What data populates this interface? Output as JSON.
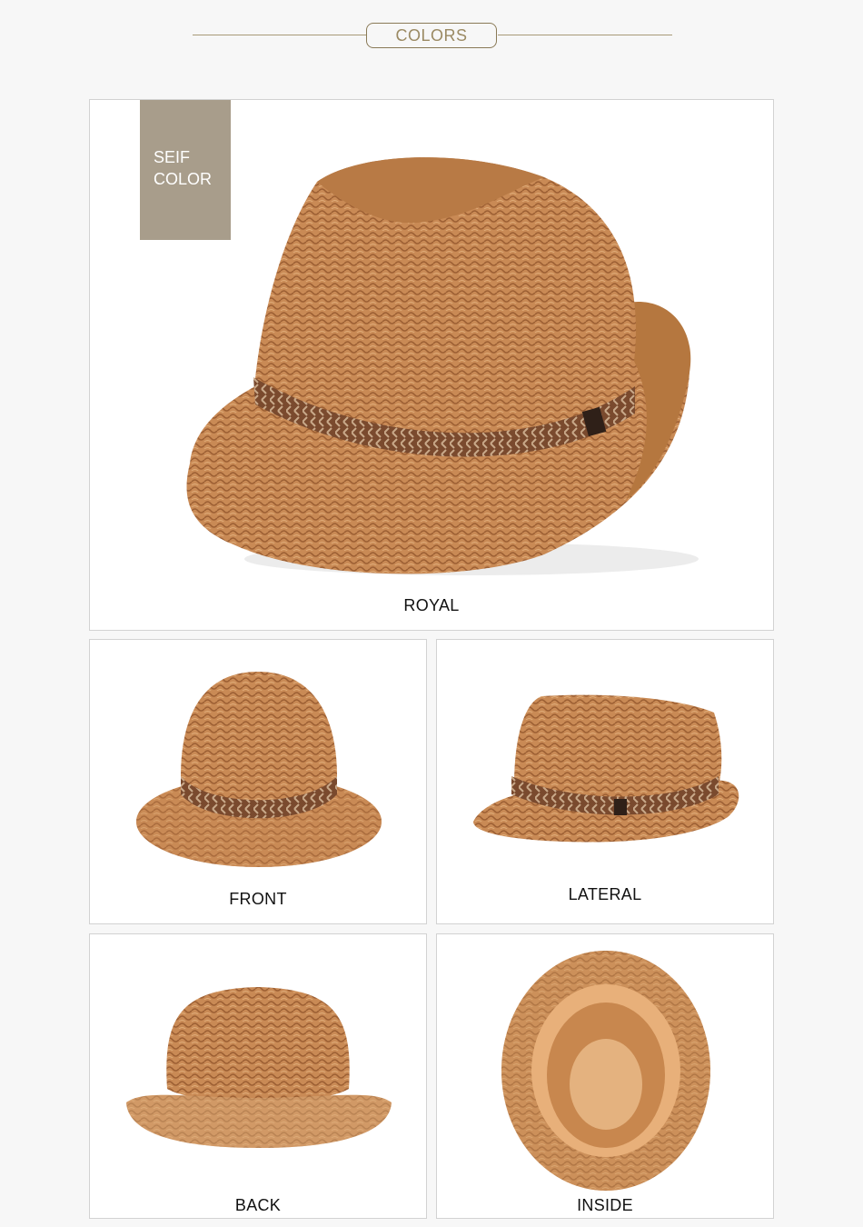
{
  "header": {
    "title": "COLORS"
  },
  "main": {
    "badge": {
      "line1": "SEIF",
      "line2": "COLOR"
    },
    "label": "ROYAL"
  },
  "views": [
    {
      "label": "FRONT"
    },
    {
      "label": "LATERAL"
    },
    {
      "label": "BACK"
    },
    {
      "label": "INSIDE"
    }
  ],
  "colors": {
    "background": "#f7f7f7",
    "accent": "#9b8a63",
    "badge": "#a89d8b",
    "straw": "#c98a55",
    "band": "#7a4a2e"
  }
}
